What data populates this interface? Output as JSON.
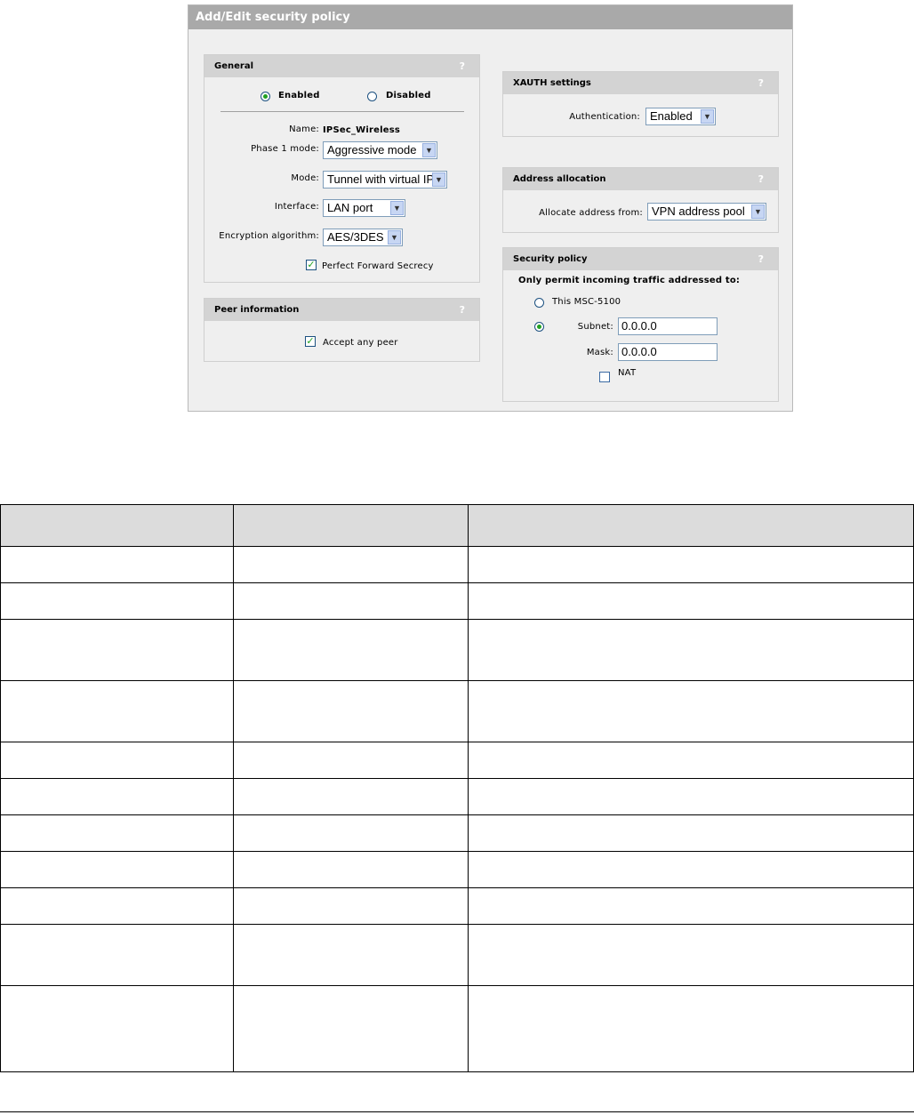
{
  "window": {
    "title": "Add/Edit security policy"
  },
  "general": {
    "heading": "General",
    "help": "?",
    "enabled_label": "Enabled",
    "disabled_label": "Disabled",
    "selected_state": "Enabled",
    "name_label": "Name:",
    "name_value": "IPSec_Wireless",
    "phase1_label": "Phase 1 mode:",
    "phase1_value": "Aggressive mode",
    "mode_label": "Mode:",
    "mode_value": "Tunnel with virtual IP",
    "interface_label": "Interface:",
    "interface_value": "LAN port",
    "encryption_label": "Encryption algorithm:",
    "encryption_value": "AES/3DES",
    "pfs_label": "Perfect Forward Secrecy",
    "pfs_checked": true
  },
  "peer": {
    "heading": "Peer information",
    "help": "?",
    "accept_label": "Accept any peer",
    "accept_checked": true
  },
  "xauth": {
    "heading": "XAUTH settings",
    "help": "?",
    "auth_label": "Authentication:",
    "auth_value": "Enabled"
  },
  "address": {
    "heading": "Address allocation",
    "help": "?",
    "alloc_label": "Allocate address from:",
    "alloc_value": "VPN address pool"
  },
  "security": {
    "heading": "Security policy",
    "help": "?",
    "permit_label": "Only permit incoming traffic addressed to:",
    "this_label": "This MSC-5100",
    "subnet_label": "Subnet:",
    "subnet_value": "0.0.0.0",
    "mask_label": "Mask:",
    "mask_value": "0.0.0.0",
    "nat_label": "NAT",
    "nat_checked": false,
    "selected_option": "Subnet"
  },
  "doc_table": {
    "rows": 11
  },
  "colors": {
    "title_bar": "#a9a9a9",
    "panel_header": "#d3d3d3",
    "panel_bg": "#efefef",
    "radio_dot": "#21a121"
  }
}
